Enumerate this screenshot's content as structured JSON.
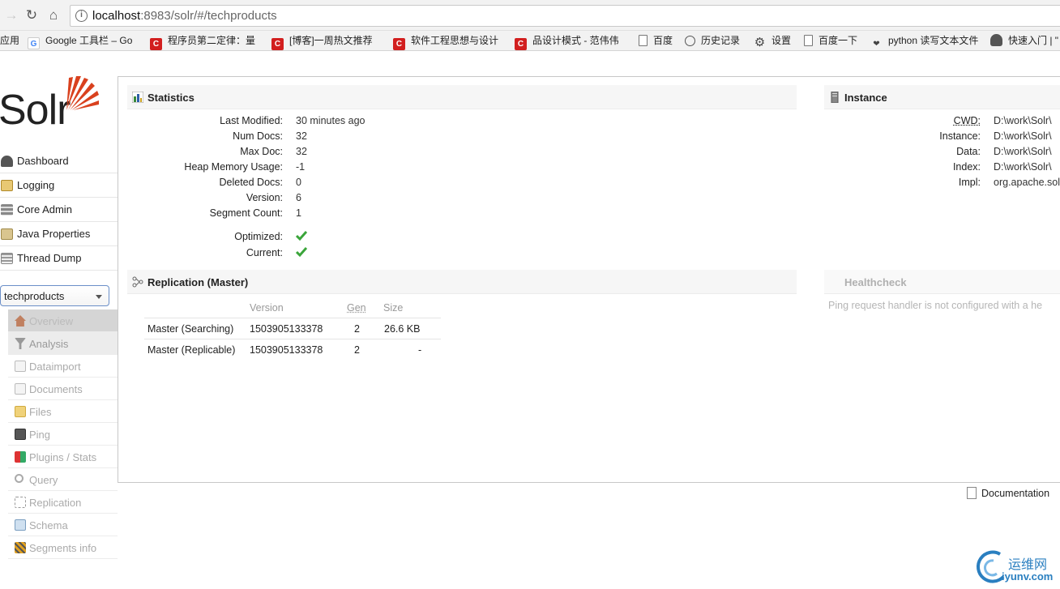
{
  "browser": {
    "url_host": "localhost",
    "url_rest": ":8983/solr/#/techproducts",
    "bookmarks": [
      "应用",
      "Google 工具栏 – Go",
      "程序员第二定律：量",
      "[博客]一周热文推荐",
      "软件工程思想与设计",
      "品设计模式 - 范伟伟",
      "百度",
      "历史记录",
      "设置",
      "百度一下",
      "python 读写文本文件",
      "快速入门 | \""
    ]
  },
  "logo": {
    "text": "Solr"
  },
  "nav": {
    "items": [
      {
        "label": "Dashboard",
        "icon": "dashboard-icon"
      },
      {
        "label": "Logging",
        "icon": "logging-icon"
      },
      {
        "label": "Core Admin",
        "icon": "core-admin-icon"
      },
      {
        "label": "Java Properties",
        "icon": "java-properties-icon"
      },
      {
        "label": "Thread Dump",
        "icon": "thread-dump-icon"
      }
    ],
    "core_selector": "techproducts",
    "core_menu": [
      {
        "label": "Overview",
        "icon": "home-icon"
      },
      {
        "label": "Analysis",
        "icon": "funnel-icon"
      },
      {
        "label": "Dataimport",
        "icon": "dataimport-icon"
      },
      {
        "label": "Documents",
        "icon": "documents-icon"
      },
      {
        "label": "Files",
        "icon": "files-icon"
      },
      {
        "label": "Ping",
        "icon": "ping-icon"
      },
      {
        "label": "Plugins / Stats",
        "icon": "plugins-icon"
      },
      {
        "label": "Query",
        "icon": "query-icon"
      },
      {
        "label": "Replication",
        "icon": "replication-icon"
      },
      {
        "label": "Schema",
        "icon": "schema-icon"
      },
      {
        "label": "Segments info",
        "icon": "segments-icon"
      }
    ]
  },
  "statistics": {
    "title": "Statistics",
    "rows": [
      {
        "key": "Last Modified:",
        "value": "30 minutes ago"
      },
      {
        "key": "Num Docs:",
        "value": "32"
      },
      {
        "key": "Max Doc:",
        "value": "32"
      },
      {
        "key": "Heap Memory Usage:",
        "value": "-1"
      },
      {
        "key": "Deleted Docs:",
        "value": "0"
      },
      {
        "key": "Version:",
        "value": "6"
      },
      {
        "key": "Segment Count:",
        "value": "1"
      }
    ],
    "optimized_label": "Optimized:",
    "current_label": "Current:"
  },
  "replication": {
    "title": "Replication (Master)",
    "headers": {
      "version": "Version",
      "gen": "Gen",
      "size": "Size"
    },
    "rows": [
      {
        "name": "Master (Searching)",
        "version": "1503905133378",
        "gen": "2",
        "size": "26.6 KB"
      },
      {
        "name": "Master (Replicable)",
        "version": "1503905133378",
        "gen": "2",
        "size": "-"
      }
    ]
  },
  "instance": {
    "title": "Instance",
    "rows": [
      {
        "key": "CWD:",
        "value": "D:\\work\\Solr\\"
      },
      {
        "key": "Instance:",
        "value": "D:\\work\\Solr\\"
      },
      {
        "key": "Data:",
        "value": "D:\\work\\Solr\\"
      },
      {
        "key": "Index:",
        "value": "D:\\work\\Solr\\"
      },
      {
        "key": "Impl:",
        "value": "org.apache.sol"
      }
    ]
  },
  "healthcheck": {
    "title": "Healthcheck",
    "message": "Ping request handler is not configured with a he"
  },
  "footer": {
    "documentation": "Documentation"
  },
  "watermark": {
    "cn": "运维网",
    "en": "iyunv.com"
  },
  "colors": {
    "check_green": "#3aa53a",
    "solr_red": "#d9411e",
    "link_blue": "#2a7fc0"
  }
}
